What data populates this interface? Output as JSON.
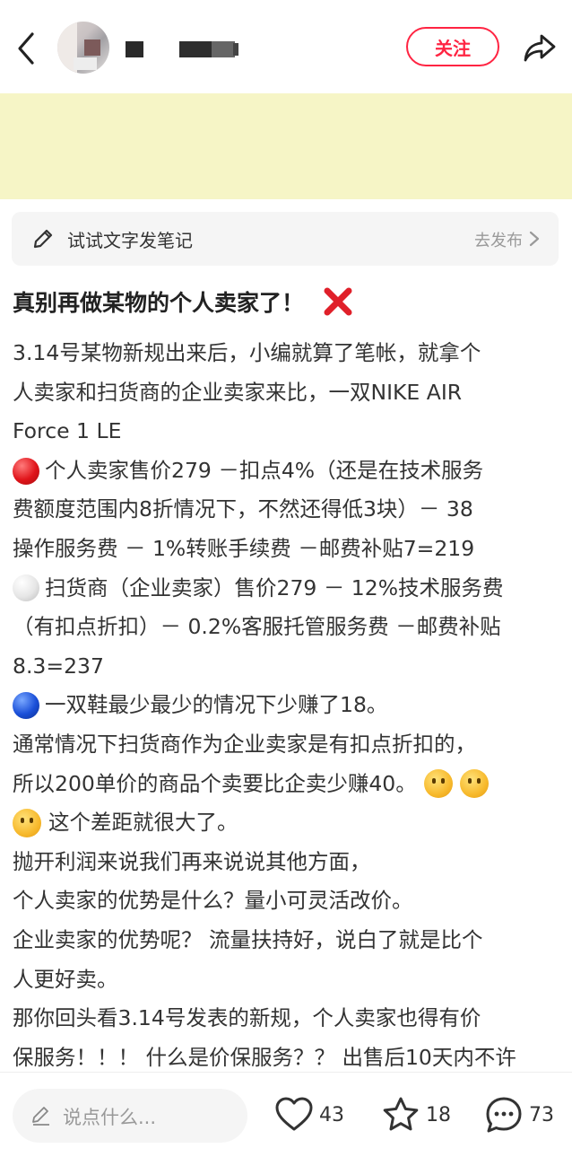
{
  "header": {
    "follow_label": "关注"
  },
  "try_note": {
    "label": "试试文字发笔记",
    "action": "去发布"
  },
  "post": {
    "title": "真别再做某物的个人卖家了！",
    "lines": [
      "3.14号某物新规出来后，小编就算了笔帐，就拿个",
      "人卖家和扫货商的企业卖家来比，一双NIKE AIR",
      "Force 1 LE",
      "个人卖家售价279 －扣点4%（还是在技术服务",
      "费额度范围内8折情况下，不然还得低3块）－ 38",
      "操作服务费 － 1%转账手续费 －邮费补贴7=219",
      "扫货商（企业卖家）售价279 － 12%技术服务费",
      "（有扣点折扣）－ 0.2%客服托管服务费 －邮费补贴",
      "8.3=237",
      "一双鞋最少最少的情况下少赚了18。",
      "通常情况下扫货商作为企业卖家是有扣点折扣的，",
      "所以200单价的商品个卖要比企卖少赚40。",
      "这个差距就很大了。",
      "抛开利润来说我们再来说说其他方面，",
      "个人卖家的优势是什么？量小可灵活改价。",
      "企业卖家的优势呢？ 流量扶持好，说白了就是比个",
      "人更好卖。",
      "那你回头看3.14号发表的新规，个人卖家也得有价",
      "保服务！！！ 什么是价保服务？？ 出售后10天内不许"
    ]
  },
  "bottom_bar": {
    "comment_placeholder": "说点什么...",
    "likes": "43",
    "favorites": "18",
    "comments": "73"
  },
  "colors": {
    "accent": "#ff2442",
    "banner": "#f6f5c6"
  }
}
